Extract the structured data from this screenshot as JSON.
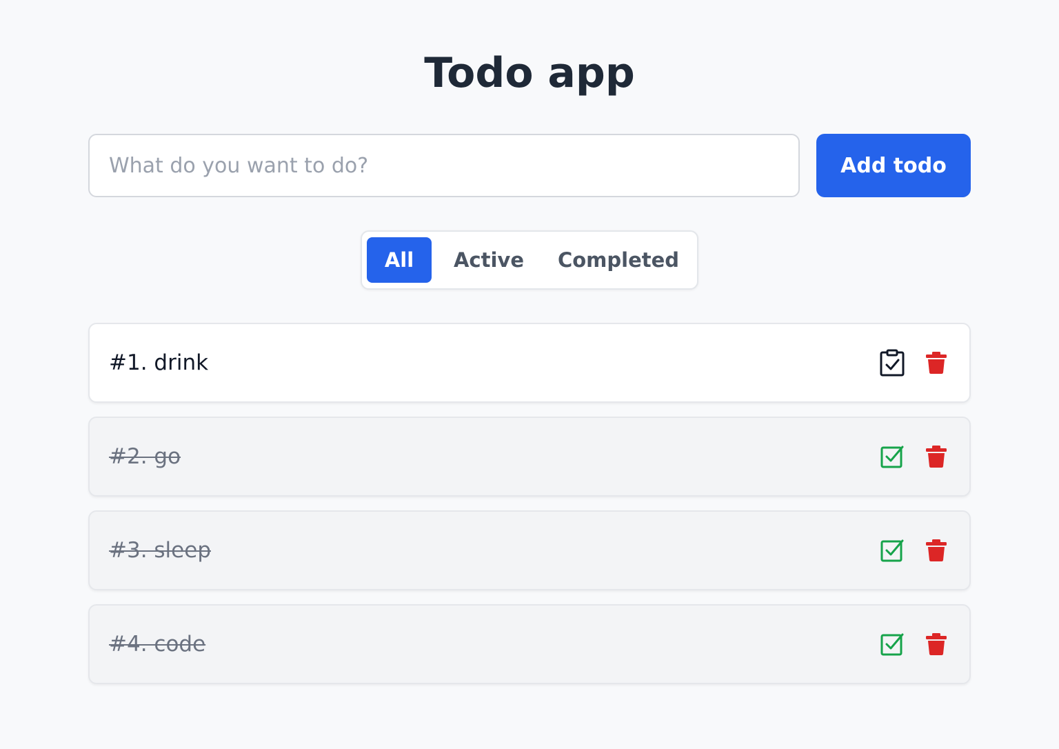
{
  "app": {
    "title": "Todo app"
  },
  "new_todo": {
    "placeholder": "What do you want to do?",
    "value": "",
    "add_label": "Add todo"
  },
  "filters": {
    "selected": "All",
    "items": [
      {
        "label": "All"
      },
      {
        "label": "Active"
      },
      {
        "label": "Completed"
      }
    ]
  },
  "todos": [
    {
      "text": "#1. drink",
      "completed": false,
      "toggle_icon": "clipboard-check-icon",
      "delete_icon": "trash-icon"
    },
    {
      "text": "#2. go",
      "completed": true,
      "toggle_icon": "checkbox-checked-icon",
      "delete_icon": "trash-icon"
    },
    {
      "text": "#3. sleep",
      "completed": true,
      "toggle_icon": "checkbox-checked-icon",
      "delete_icon": "trash-icon"
    },
    {
      "text": "#4. code",
      "completed": true,
      "toggle_icon": "checkbox-checked-icon",
      "delete_icon": "trash-icon"
    }
  ],
  "colors": {
    "primary": "#2563eb",
    "delete": "#dc2626",
    "completed_check": "#16a34a",
    "title": "#1f2937"
  }
}
